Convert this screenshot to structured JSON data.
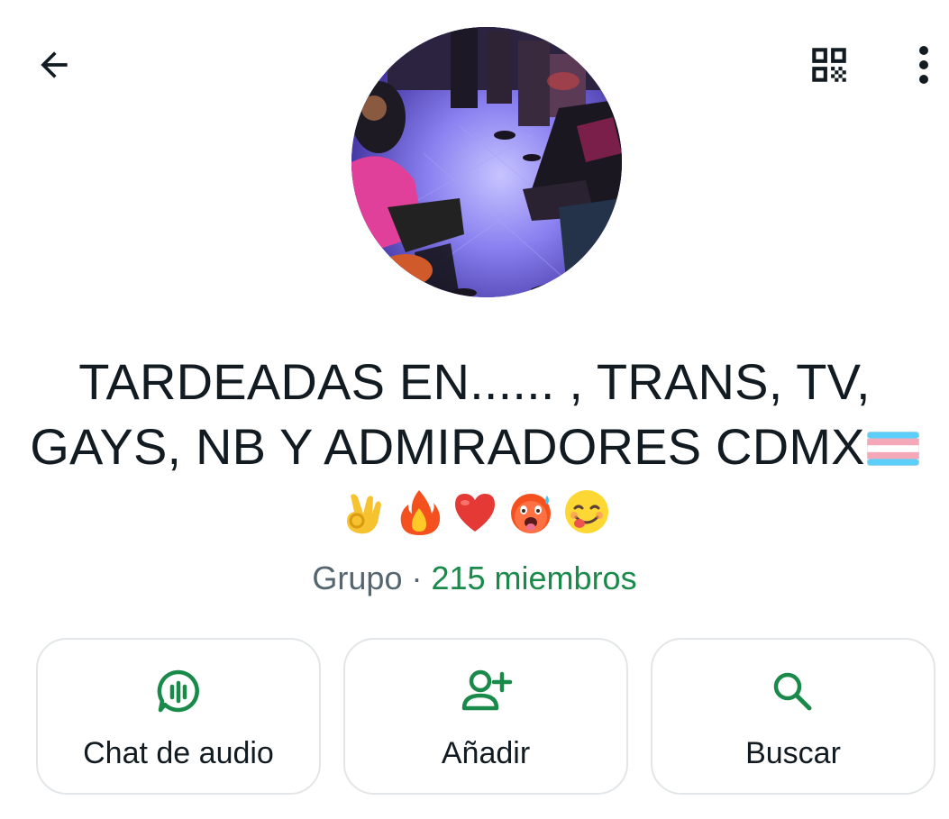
{
  "header": {
    "back_icon": "arrow-back-icon",
    "qr_icon": "qr-code-icon",
    "menu_icon": "more-vert-icon"
  },
  "group": {
    "title_line1": "TARDEADAS EN...... , TRANS, TV,",
    "title_line2": "GAYS, NB Y ADMIRADORES CDMX",
    "title_emojis": [
      "transgender-flag",
      "ok-hand",
      "fire",
      "red-heart",
      "hot-face",
      "yum-face"
    ],
    "type_label": "Grupo",
    "separator": " · ",
    "members_label": "215 miembros"
  },
  "actions": [
    {
      "label": "Chat de audio",
      "icon": "audio-chat-icon"
    },
    {
      "label": "Añadir",
      "icon": "add-person-icon"
    },
    {
      "label": "Buscar",
      "icon": "search-icon"
    }
  ],
  "colors": {
    "accent": "#1a8a4a",
    "text_primary": "#111b21",
    "text_secondary": "#54656f",
    "card_border": "#e3e6e8"
  }
}
